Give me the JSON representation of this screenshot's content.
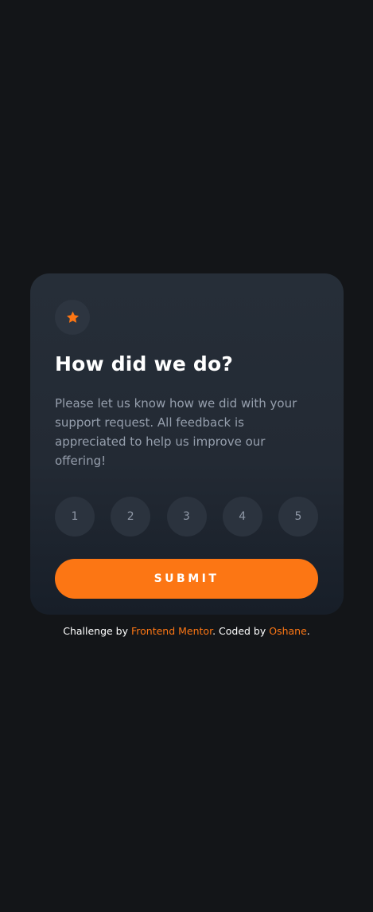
{
  "colors": {
    "background": "#131518",
    "card_top": "#262e38",
    "card_bottom": "#171e28",
    "accent": "#fc7614",
    "rating_bg": "#2b333e",
    "muted_text": "#969fad"
  },
  "card": {
    "icon": "star-icon",
    "title": "How did we do?",
    "description": "Please let us know how we did with your support request. All feedback is appreciated to help us improve our offering!",
    "ratings": [
      "1",
      "2",
      "3",
      "4",
      "5"
    ],
    "submit_label": "SUBMIT"
  },
  "attribution": {
    "prefix": "Challenge by ",
    "challenge_link": "Frontend Mentor",
    "middle": ". Coded by ",
    "author_link": "Oshane",
    "suffix": "."
  }
}
